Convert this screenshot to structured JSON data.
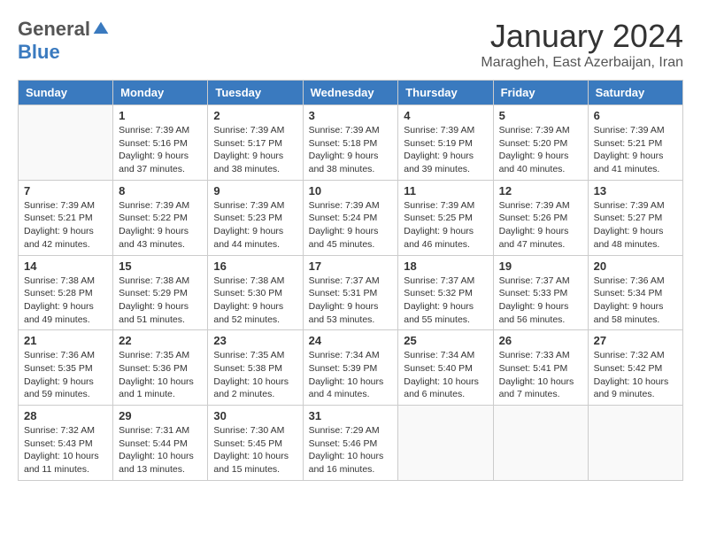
{
  "logo": {
    "general": "General",
    "blue": "Blue"
  },
  "title": "January 2024",
  "location": "Maragheh, East Azerbaijan, Iran",
  "days_of_week": [
    "Sunday",
    "Monday",
    "Tuesday",
    "Wednesday",
    "Thursday",
    "Friday",
    "Saturday"
  ],
  "weeks": [
    [
      {
        "day": "",
        "sunrise": "",
        "sunset": "",
        "daylight": ""
      },
      {
        "day": "1",
        "sunrise": "Sunrise: 7:39 AM",
        "sunset": "Sunset: 5:16 PM",
        "daylight": "Daylight: 9 hours and 37 minutes."
      },
      {
        "day": "2",
        "sunrise": "Sunrise: 7:39 AM",
        "sunset": "Sunset: 5:17 PM",
        "daylight": "Daylight: 9 hours and 38 minutes."
      },
      {
        "day": "3",
        "sunrise": "Sunrise: 7:39 AM",
        "sunset": "Sunset: 5:18 PM",
        "daylight": "Daylight: 9 hours and 38 minutes."
      },
      {
        "day": "4",
        "sunrise": "Sunrise: 7:39 AM",
        "sunset": "Sunset: 5:19 PM",
        "daylight": "Daylight: 9 hours and 39 minutes."
      },
      {
        "day": "5",
        "sunrise": "Sunrise: 7:39 AM",
        "sunset": "Sunset: 5:20 PM",
        "daylight": "Daylight: 9 hours and 40 minutes."
      },
      {
        "day": "6",
        "sunrise": "Sunrise: 7:39 AM",
        "sunset": "Sunset: 5:21 PM",
        "daylight": "Daylight: 9 hours and 41 minutes."
      }
    ],
    [
      {
        "day": "7",
        "sunrise": "Sunrise: 7:39 AM",
        "sunset": "Sunset: 5:21 PM",
        "daylight": "Daylight: 9 hours and 42 minutes."
      },
      {
        "day": "8",
        "sunrise": "Sunrise: 7:39 AM",
        "sunset": "Sunset: 5:22 PM",
        "daylight": "Daylight: 9 hours and 43 minutes."
      },
      {
        "day": "9",
        "sunrise": "Sunrise: 7:39 AM",
        "sunset": "Sunset: 5:23 PM",
        "daylight": "Daylight: 9 hours and 44 minutes."
      },
      {
        "day": "10",
        "sunrise": "Sunrise: 7:39 AM",
        "sunset": "Sunset: 5:24 PM",
        "daylight": "Daylight: 9 hours and 45 minutes."
      },
      {
        "day": "11",
        "sunrise": "Sunrise: 7:39 AM",
        "sunset": "Sunset: 5:25 PM",
        "daylight": "Daylight: 9 hours and 46 minutes."
      },
      {
        "day": "12",
        "sunrise": "Sunrise: 7:39 AM",
        "sunset": "Sunset: 5:26 PM",
        "daylight": "Daylight: 9 hours and 47 minutes."
      },
      {
        "day": "13",
        "sunrise": "Sunrise: 7:39 AM",
        "sunset": "Sunset: 5:27 PM",
        "daylight": "Daylight: 9 hours and 48 minutes."
      }
    ],
    [
      {
        "day": "14",
        "sunrise": "Sunrise: 7:38 AM",
        "sunset": "Sunset: 5:28 PM",
        "daylight": "Daylight: 9 hours and 49 minutes."
      },
      {
        "day": "15",
        "sunrise": "Sunrise: 7:38 AM",
        "sunset": "Sunset: 5:29 PM",
        "daylight": "Daylight: 9 hours and 51 minutes."
      },
      {
        "day": "16",
        "sunrise": "Sunrise: 7:38 AM",
        "sunset": "Sunset: 5:30 PM",
        "daylight": "Daylight: 9 hours and 52 minutes."
      },
      {
        "day": "17",
        "sunrise": "Sunrise: 7:37 AM",
        "sunset": "Sunset: 5:31 PM",
        "daylight": "Daylight: 9 hours and 53 minutes."
      },
      {
        "day": "18",
        "sunrise": "Sunrise: 7:37 AM",
        "sunset": "Sunset: 5:32 PM",
        "daylight": "Daylight: 9 hours and 55 minutes."
      },
      {
        "day": "19",
        "sunrise": "Sunrise: 7:37 AM",
        "sunset": "Sunset: 5:33 PM",
        "daylight": "Daylight: 9 hours and 56 minutes."
      },
      {
        "day": "20",
        "sunrise": "Sunrise: 7:36 AM",
        "sunset": "Sunset: 5:34 PM",
        "daylight": "Daylight: 9 hours and 58 minutes."
      }
    ],
    [
      {
        "day": "21",
        "sunrise": "Sunrise: 7:36 AM",
        "sunset": "Sunset: 5:35 PM",
        "daylight": "Daylight: 9 hours and 59 minutes."
      },
      {
        "day": "22",
        "sunrise": "Sunrise: 7:35 AM",
        "sunset": "Sunset: 5:36 PM",
        "daylight": "Daylight: 10 hours and 1 minute."
      },
      {
        "day": "23",
        "sunrise": "Sunrise: 7:35 AM",
        "sunset": "Sunset: 5:38 PM",
        "daylight": "Daylight: 10 hours and 2 minutes."
      },
      {
        "day": "24",
        "sunrise": "Sunrise: 7:34 AM",
        "sunset": "Sunset: 5:39 PM",
        "daylight": "Daylight: 10 hours and 4 minutes."
      },
      {
        "day": "25",
        "sunrise": "Sunrise: 7:34 AM",
        "sunset": "Sunset: 5:40 PM",
        "daylight": "Daylight: 10 hours and 6 minutes."
      },
      {
        "day": "26",
        "sunrise": "Sunrise: 7:33 AM",
        "sunset": "Sunset: 5:41 PM",
        "daylight": "Daylight: 10 hours and 7 minutes."
      },
      {
        "day": "27",
        "sunrise": "Sunrise: 7:32 AM",
        "sunset": "Sunset: 5:42 PM",
        "daylight": "Daylight: 10 hours and 9 minutes."
      }
    ],
    [
      {
        "day": "28",
        "sunrise": "Sunrise: 7:32 AM",
        "sunset": "Sunset: 5:43 PM",
        "daylight": "Daylight: 10 hours and 11 minutes."
      },
      {
        "day": "29",
        "sunrise": "Sunrise: 7:31 AM",
        "sunset": "Sunset: 5:44 PM",
        "daylight": "Daylight: 10 hours and 13 minutes."
      },
      {
        "day": "30",
        "sunrise": "Sunrise: 7:30 AM",
        "sunset": "Sunset: 5:45 PM",
        "daylight": "Daylight: 10 hours and 15 minutes."
      },
      {
        "day": "31",
        "sunrise": "Sunrise: 7:29 AM",
        "sunset": "Sunset: 5:46 PM",
        "daylight": "Daylight: 10 hours and 16 minutes."
      },
      {
        "day": "",
        "sunrise": "",
        "sunset": "",
        "daylight": ""
      },
      {
        "day": "",
        "sunrise": "",
        "sunset": "",
        "daylight": ""
      },
      {
        "day": "",
        "sunrise": "",
        "sunset": "",
        "daylight": ""
      }
    ]
  ]
}
